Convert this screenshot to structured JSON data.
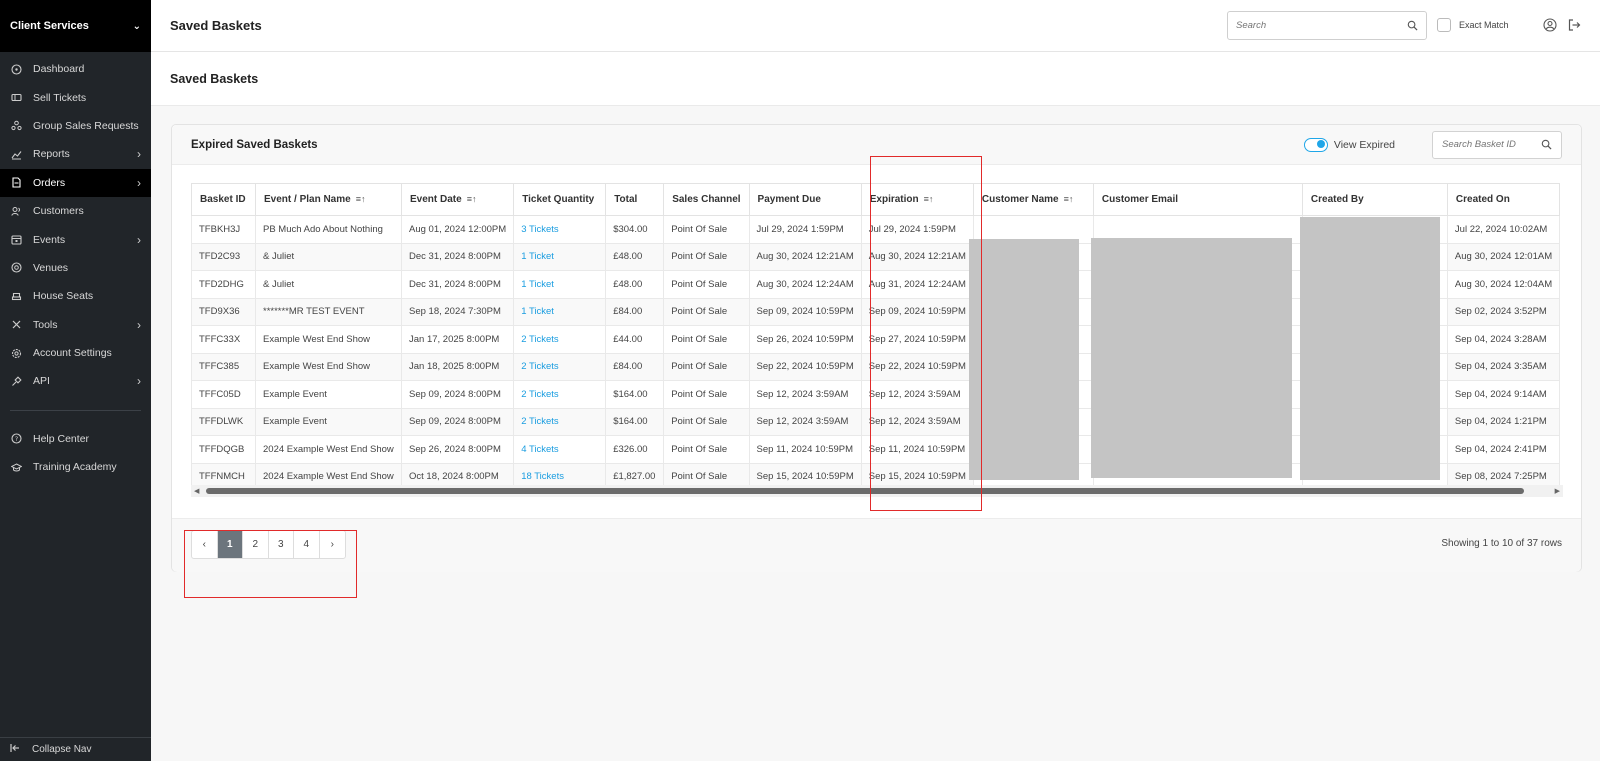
{
  "sidebar": {
    "header": "Client Services",
    "items": [
      {
        "label": "Dashboard",
        "icon": "dashboard-icon",
        "arrow": false
      },
      {
        "label": "Sell Tickets",
        "icon": "ticket-icon",
        "arrow": false
      },
      {
        "label": "Group Sales Requests",
        "icon": "group-icon",
        "arrow": false
      },
      {
        "label": "Reports",
        "icon": "chart-icon",
        "arrow": true
      },
      {
        "label": "Orders",
        "icon": "document-icon",
        "arrow": true,
        "active": true
      },
      {
        "label": "Customers",
        "icon": "users-icon",
        "arrow": false
      },
      {
        "label": "Events",
        "icon": "calendar-icon",
        "arrow": true
      },
      {
        "label": "Venues",
        "icon": "location-pin-icon",
        "arrow": false
      },
      {
        "label": "House Seats",
        "icon": "seat-icon",
        "arrow": false
      },
      {
        "label": "Tools",
        "icon": "tools-icon",
        "arrow": true
      },
      {
        "label": "Account Settings",
        "icon": "gear-icon",
        "arrow": false
      },
      {
        "label": "API",
        "icon": "plug-icon",
        "arrow": true
      }
    ],
    "bottom_items": [
      {
        "label": "Help Center",
        "icon": "help-icon"
      },
      {
        "label": "Training Academy",
        "icon": "graduation-cap-icon"
      }
    ],
    "collapse": "Collapse Nav"
  },
  "topbar": {
    "title": "Saved Baskets",
    "search_placeholder": "Search",
    "exact_match": "Exact Match"
  },
  "page": {
    "title": "Saved Baskets"
  },
  "card": {
    "title": "Expired Saved Baskets",
    "view_expired": "View Expired",
    "basket_search_placeholder": "Search Basket ID"
  },
  "table": {
    "columns": [
      "Basket ID",
      "Event / Plan Name",
      "Event Date",
      "Ticket Quantity",
      "Total",
      "Sales Channel",
      "Payment Due",
      "Expiration",
      "Customer Name",
      "Customer Email",
      "Created By",
      "Created On"
    ],
    "rows": [
      [
        "TFBKH3J",
        "PB Much Ado About Nothing",
        "Aug 01, 2024 12:00PM",
        "3 Tickets",
        "$304.00",
        "Point Of Sale",
        "Jul 29, 2024 1:59PM",
        "Jul 29, 2024 1:59PM",
        "",
        "",
        "",
        "Jul 22, 2024 10:02AM"
      ],
      [
        "TFD2C93",
        "& Juliet",
        "Dec 31, 2024 8:00PM",
        "1 Ticket",
        "£48.00",
        "Point Of Sale",
        "Aug 30, 2024 12:21AM",
        "Aug 30, 2024 12:21AM",
        "",
        "",
        "",
        "Aug 30, 2024 12:01AM"
      ],
      [
        "TFD2DHG",
        "& Juliet",
        "Dec 31, 2024 8:00PM",
        "1 Ticket",
        "£48.00",
        "Point Of Sale",
        "Aug 30, 2024 12:24AM",
        "Aug 31, 2024 12:24AM",
        "",
        "",
        "",
        "Aug 30, 2024 12:04AM"
      ],
      [
        "TFD9X36",
        "*******MR TEST EVENT",
        "Sep 18, 2024 7:30PM",
        "1 Ticket",
        "£84.00",
        "Point Of Sale",
        "Sep 09, 2024 10:59PM",
        "Sep 09, 2024 10:59PM",
        "",
        "",
        "",
        "Sep 02, 2024 3:52PM"
      ],
      [
        "TFFC33X",
        "Example West End Show",
        "Jan 17, 2025 8:00PM",
        "2 Tickets",
        "£44.00",
        "Point Of Sale",
        "Sep 26, 2024 10:59PM",
        "Sep 27, 2024 10:59PM",
        "",
        "",
        "",
        "Sep 04, 2024 3:28AM"
      ],
      [
        "TFFC385",
        "Example West End Show",
        "Jan 18, 2025 8:00PM",
        "2 Tickets",
        "£84.00",
        "Point Of Sale",
        "Sep 22, 2024 10:59PM",
        "Sep 22, 2024 10:59PM",
        "",
        "",
        "",
        "Sep 04, 2024 3:35AM"
      ],
      [
        "TFFC05D",
        "Example Event",
        "Sep 09, 2024 8:00PM",
        "2 Tickets",
        "$164.00",
        "Point Of Sale",
        "Sep 12, 2024 3:59AM",
        "Sep 12, 2024 3:59AM",
        "",
        "",
        "",
        "Sep 04, 2024 9:14AM"
      ],
      [
        "TFFDLWK",
        "Example Event",
        "Sep 09, 2024 8:00PM",
        "2 Tickets",
        "$164.00",
        "Point Of Sale",
        "Sep 12, 2024 3:59AM",
        "Sep 12, 2024 3:59AM",
        "",
        "",
        "",
        "Sep 04, 2024 1:21PM"
      ],
      [
        "TFFDQGB",
        "2024 Example West End Show",
        "Sep 26, 2024 8:00PM",
        "4 Tickets",
        "£326.00",
        "Point Of Sale",
        "Sep 11, 2024 10:59PM",
        "Sep 11, 2024 10:59PM",
        "",
        "",
        "",
        "Sep 04, 2024 2:41PM"
      ],
      [
        "TFFNMCH",
        "2024 Example West End Show",
        "Oct 18, 2024 8:00PM",
        "18 Tickets",
        "£1,827.00",
        "Point Of Sale",
        "Sep 15, 2024 10:59PM",
        "Sep 15, 2024 10:59PM",
        "",
        "",
        "",
        "Sep 08, 2024 7:25PM"
      ]
    ]
  },
  "pagination": {
    "pages": [
      "1",
      "2",
      "3",
      "4"
    ],
    "current": "1",
    "prev": "‹",
    "next": "›",
    "showing": "Showing 1 to 10 of 37 rows"
  },
  "colors": {
    "sidebar_bg": "#212529",
    "accent": "#1a9de0",
    "highlight_box": "#e12a2a"
  }
}
